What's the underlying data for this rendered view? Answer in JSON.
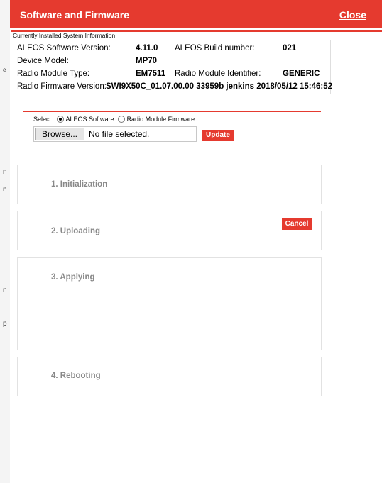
{
  "dialog": {
    "title": "Software and Firmware",
    "close_label": "Close",
    "accent_color": "#e53a2f"
  },
  "background_glyphs": [
    "n",
    "n",
    "e",
    "n",
    "n",
    "p"
  ],
  "system_info": {
    "caption": "Currently Installed System Information",
    "software_version_label": "ALEOS Software Version:",
    "software_version": "4.11.0",
    "build_number_label": "ALEOS Build number:",
    "build_number": "021",
    "device_model_label": "Device Model:",
    "device_model": "MP70",
    "radio_module_type_label": "Radio Module Type:",
    "radio_module_type": "EM7511",
    "radio_module_id_label": "Radio Module Identifier:",
    "radio_module_id": "GENERIC",
    "radio_firmware_label": "Radio Firmware Version:",
    "radio_firmware": "SWI9X50C_01.07.00.00 33959b jenkins 2018/05/12 15:46:52"
  },
  "select": {
    "label": "Select:",
    "options": [
      "ALEOS Software",
      "Radio Module Firmware"
    ],
    "selected": "ALEOS Software"
  },
  "file": {
    "browse_label": "Browse...",
    "status": "No file selected.",
    "update_label": "Update"
  },
  "steps": [
    {
      "label": "1. Initialization"
    },
    {
      "label": "2. Uploading"
    },
    {
      "label": "3. Applying"
    },
    {
      "label": "4. Rebooting"
    }
  ],
  "cancel_label": "Cancel"
}
